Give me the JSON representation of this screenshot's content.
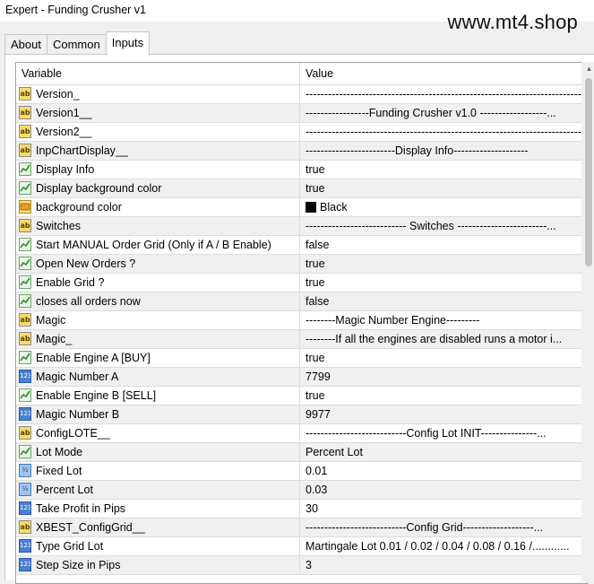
{
  "window": {
    "title": "Expert - Funding Crusher v1"
  },
  "watermark": "www.mt4.shop",
  "tabs": [
    {
      "label": "About",
      "active": false
    },
    {
      "label": "Common",
      "active": false
    },
    {
      "label": "Inputs",
      "active": true
    }
  ],
  "table": {
    "headers": {
      "variable": "Variable",
      "value": "Value"
    },
    "rows": [
      {
        "icon": "ab",
        "name": "Version_",
        "value": "------------------------------------------------------------------------------..."
      },
      {
        "icon": "ab",
        "name": "Version1__",
        "value": "-----------------Funding Crusher   v1.0 ------------------..."
      },
      {
        "icon": "ab",
        "name": "Version2__",
        "value": "------------------------------------------------------------------------------..."
      },
      {
        "icon": "ab",
        "name": "InpChartDisplay__",
        "value": "------------------------Display Info--------------------"
      },
      {
        "icon": "bool",
        "name": "Display Info",
        "value": "true"
      },
      {
        "icon": "bool",
        "name": "Display background color",
        "value": "true"
      },
      {
        "icon": "color",
        "name": "background color",
        "value": "Black",
        "swatch": "#000000"
      },
      {
        "icon": "ab",
        "name": "Switches",
        "value": "--------------------------- Switches ------------------------..."
      },
      {
        "icon": "bool",
        "name": "Start MANUAL Order  Grid  (Only if A / B Enable)",
        "value": "false"
      },
      {
        "icon": "bool",
        "name": "Open New Orders ?",
        "value": "true"
      },
      {
        "icon": "bool",
        "name": "Enable Grid ?",
        "value": "true"
      },
      {
        "icon": "bool",
        "name": "closes all orders now",
        "value": "false"
      },
      {
        "icon": "ab",
        "name": "Magic",
        "value": "--------Magic Number Engine---------"
      },
      {
        "icon": "ab",
        "name": "Magic_",
        "value": "--------If all the engines are disabled runs a motor i..."
      },
      {
        "icon": "bool",
        "name": "Enable Engine A   [BUY]",
        "value": "true"
      },
      {
        "icon": "int",
        "name": "Magic Number  A",
        "value": "7799"
      },
      {
        "icon": "bool",
        "name": "Enable Engine B   [SELL]",
        "value": "true"
      },
      {
        "icon": "int",
        "name": "Magic Number  B",
        "value": "9977"
      },
      {
        "icon": "ab",
        "name": "ConfigLOTE__",
        "value": "---------------------------Config Lot INIT---------------..."
      },
      {
        "icon": "bool",
        "name": "Lot Mode",
        "value": "Percent Lot"
      },
      {
        "icon": "dbl",
        "name": "Fixed Lot",
        "value": "0.01"
      },
      {
        "icon": "dbl",
        "name": "Percent Lot",
        "value": "0.03"
      },
      {
        "icon": "int",
        "name": "Take Profit in Pips",
        "value": "30"
      },
      {
        "icon": "ab",
        "name": "XBEST_ConfigGrid__",
        "value": "---------------------------Config Grid-------------------..."
      },
      {
        "icon": "int",
        "name": "Type Grid Lot",
        "value": "Martingale Lot  0.01 / 0.02 / 0.04 / 0.08 / 0.16 /............"
      },
      {
        "icon": "int",
        "name": "Step Size in Pips",
        "value": "3"
      }
    ]
  }
}
